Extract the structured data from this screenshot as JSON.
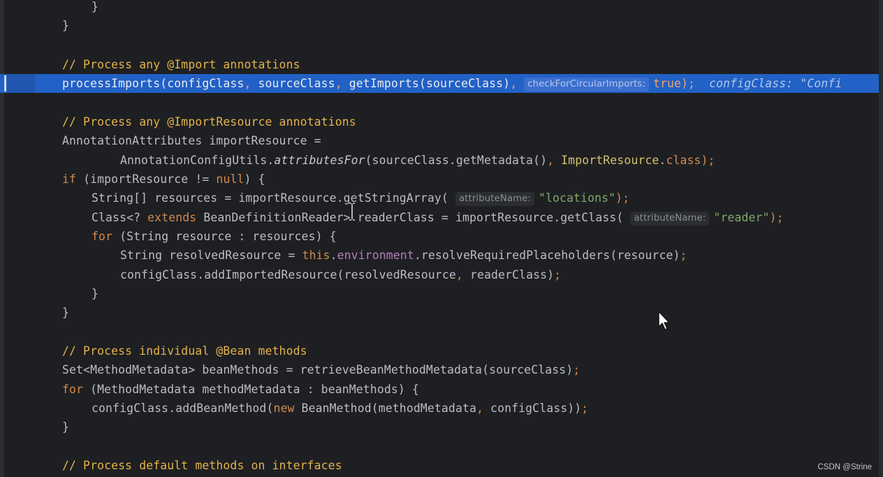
{
  "editor": {
    "lines": {
      "l1": {
        "a": "}"
      },
      "l2": {
        "a": "}"
      },
      "l3": {
        "comment": "// Process any @Import annotations"
      },
      "l4": {
        "a": "processImports(configClass",
        "b": ",",
        "c": " sourceClass",
        "d": ",",
        "e": " getImports(sourceClass)",
        "f": ",",
        "hint": "checkForCircularImports:",
        "g": "true",
        "h": ");",
        "debug": "configClass: \"Confi"
      },
      "l5": {
        "comment": "// Process any @ImportResource annotations"
      },
      "l6": {
        "a": "AnnotationAttributes importResource ="
      },
      "l7": {
        "a": "AnnotationConfigUtils.",
        "b": "attributesFor",
        "c": "(sourceClass.getMetadata()",
        "d": ",",
        "e": " ImportResource.",
        "f": "class",
        "g": ");"
      },
      "l8": {
        "kw": "if",
        "a": " (importResource != ",
        "kw2": "null",
        "b": ") {"
      },
      "l9": {
        "a": "String[] resources = importResource.getStringArray(",
        "hint": "attributeName:",
        "str": "\"locations\"",
        "b": ");"
      },
      "l10": {
        "a": "Class<? ",
        "kw": "extends",
        "b": " BeanDefinitionReader> readerClass = importResource.getClass(",
        "hint": "attributeName:",
        "str": "\"reader\"",
        "c": ");"
      },
      "l11": {
        "kw": "for",
        "a": " (String resource : resources) {"
      },
      "l12": {
        "a": "String ",
        "b": "resolvedResource",
        "c": " = ",
        "kw": "this",
        "d": ".",
        "fld": "environment",
        "e": ".resolveRequiredPlaceholders(resource)",
        "f": ";"
      },
      "l13": {
        "a": "configClass.addImportedResource(resolvedResource",
        "b": ",",
        "c": " readerClass)",
        "d": ";"
      },
      "l14": {
        "a": "}"
      },
      "l15": {
        "a": "}"
      },
      "l16": {
        "comment": "// Process individual @Bean methods"
      },
      "l17": {
        "a": "Set<MethodMetadata> beanMethods = retrieveBeanMethodMetadata(sourceClass)",
        "b": ";"
      },
      "l18": {
        "kw": "for",
        "a": " (MethodMetadata methodMetadata : beanMethods) {"
      },
      "l19": {
        "a": "configClass.addBeanMethod(",
        "kw": "new",
        "b": " BeanMethod(methodMetadata",
        "c": ",",
        "d": " configClass))",
        "e": ";"
      },
      "l20": {
        "a": "}"
      },
      "l21": {
        "comment": "// Process default methods on interfaces"
      }
    }
  },
  "watermark": "CSDN @Strine",
  "colors": {
    "background": "#1e1f22",
    "highlight": "#2261c6",
    "comment": "#e4b34b",
    "keyword": "#d18a4d",
    "string": "#7fa86c",
    "field": "#b57fbd"
  },
  "icons": {
    "text_cursor": "ibeam-cursor-icon",
    "mouse_pointer": "arrow-cursor-icon"
  }
}
